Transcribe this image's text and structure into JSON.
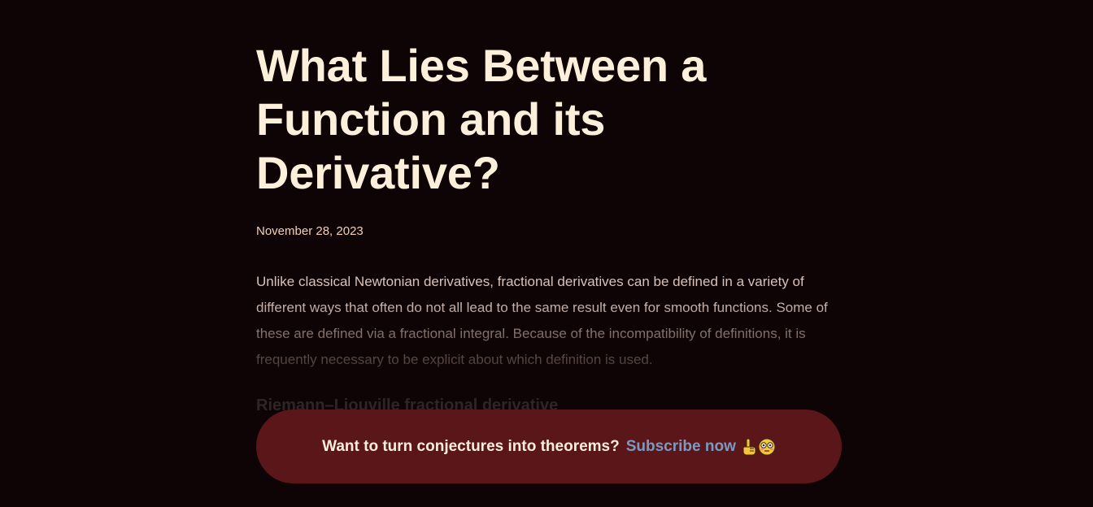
{
  "article": {
    "title_line1": "What Lies Between a",
    "title_line2": "Function and its Derivative?",
    "date": "November 28, 2023",
    "intro": "Unlike classical Newtonian derivatives, fractional derivatives can be defined in a variety of different ways that often do not all lead to the same result even for smooth functions. Some of these are defined via a fractional integral. Because of the incompatibility of definitions, it is frequently necessary to be explicit about which definition is used.",
    "section_heading": "Riemann–Liouville fractional derivative"
  },
  "subscribe": {
    "prompt": "Want to turn conjectures into theorems?",
    "link_label": "Subscribe now",
    "icons": [
      "pointing-up-icon",
      "flushed-face-icon"
    ]
  },
  "colors": {
    "background": "#0f0405",
    "title": "#fdf0db",
    "bar": "#5b161a",
    "link": "#7a9ac2"
  }
}
